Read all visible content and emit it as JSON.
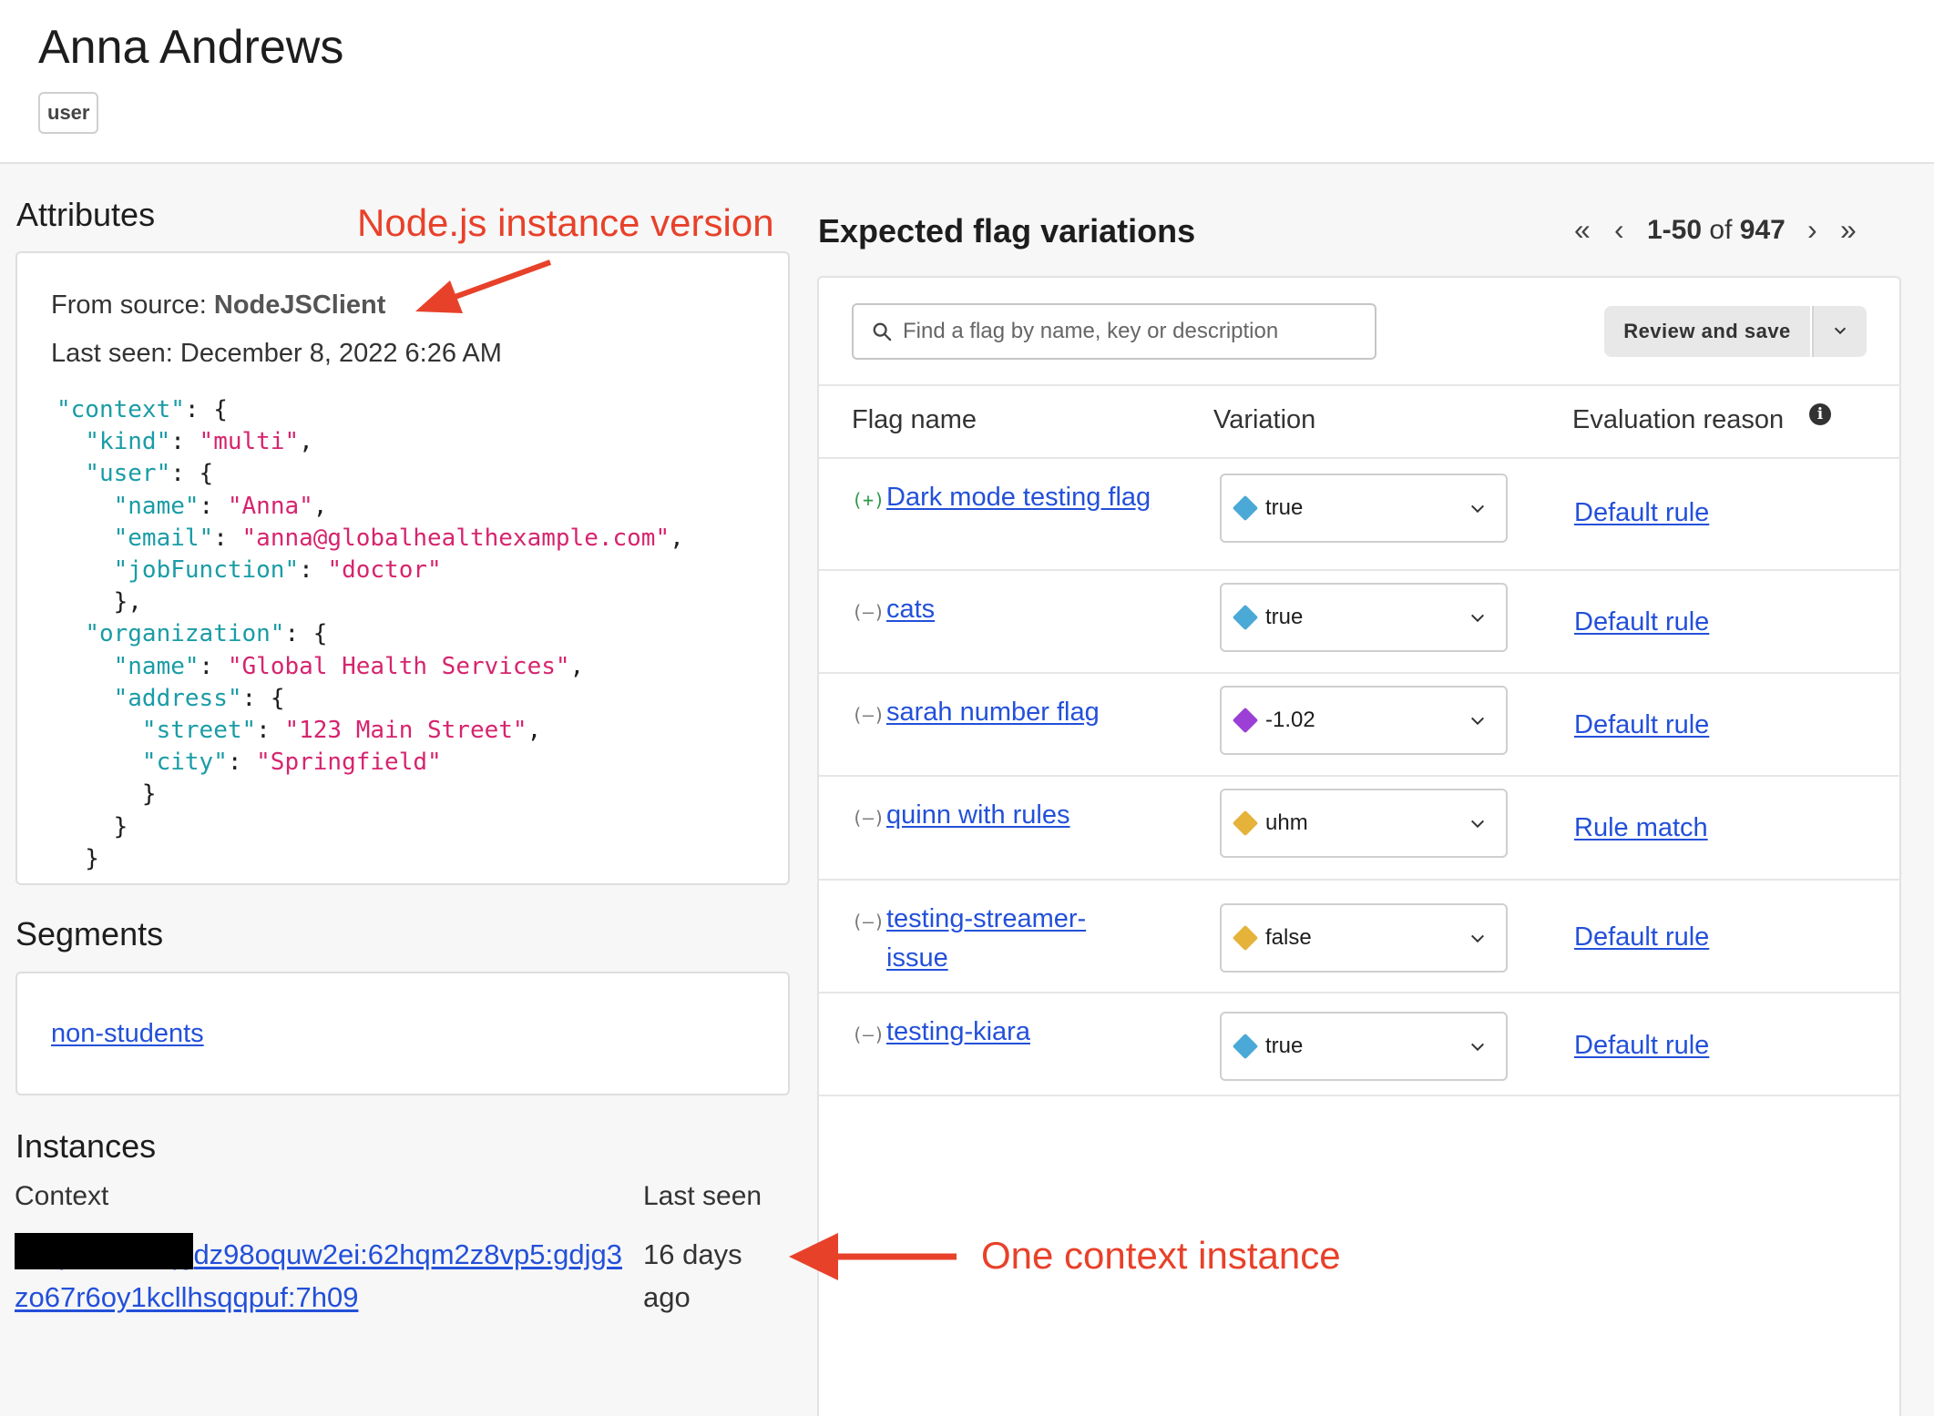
{
  "header": {
    "title": "Anna Andrews",
    "kind_badge": "user"
  },
  "attributes": {
    "heading": "Attributes",
    "source_label": "From source: ",
    "source_value": "NodeJSClient",
    "last_seen": "Last seen: December 8, 2022 6:26 AM"
  },
  "segments": {
    "heading": "Segments",
    "items": [
      "non-students"
    ]
  },
  "instances": {
    "heading": "Instances",
    "col_context": "Context",
    "col_last_seen": "Last seen",
    "rows": [
      {
        "context": "cbvpxso1csqgdz98oquw2ei:62hqm2z8vp5:gdjg3zo67r6oy1kcllhsqqpuf:7h09",
        "last_seen": "16 days ago"
      }
    ]
  },
  "flags": {
    "heading": "Expected flag variations",
    "pagination": {
      "range": "1-50",
      "of": "of",
      "total": "947"
    },
    "search_placeholder": "Find a flag by name, key or description",
    "review_button": "Review and save",
    "columns": {
      "name": "Flag name",
      "variation": "Variation",
      "reason": "Evaluation reason"
    },
    "rows": [
      {
        "status": "(+)",
        "name": "Dark mode testing flag",
        "variation": "true",
        "color": "#4aa9d6",
        "reason": "Default rule"
      },
      {
        "status": "(–)",
        "name": "cats",
        "variation": "true",
        "color": "#4aa9d6",
        "reason": "Default rule"
      },
      {
        "status": "(–)",
        "name": "sarah number flag",
        "variation": "-1.02",
        "color": "#9b3fd6",
        "reason": "Default rule"
      },
      {
        "status": "(–)",
        "name": "quinn with rules",
        "variation": "uhm",
        "color": "#e5b23a",
        "reason": "Rule match"
      },
      {
        "status": "(–)",
        "name": "testing-streamer-issue",
        "variation": "false",
        "color": "#e5b23a",
        "reason": "Default rule"
      },
      {
        "status": "(–)",
        "name": "testing-kiara",
        "variation": "true",
        "color": "#4aa9d6",
        "reason": "Default rule"
      }
    ]
  },
  "annotations": {
    "node_version": "Node.js instance version",
    "context_instance": "One context instance"
  },
  "colors": {
    "annotation": "#e8412a",
    "link": "#2350d9",
    "json_key": "#1a9ca6",
    "json_value": "#d6246e"
  }
}
